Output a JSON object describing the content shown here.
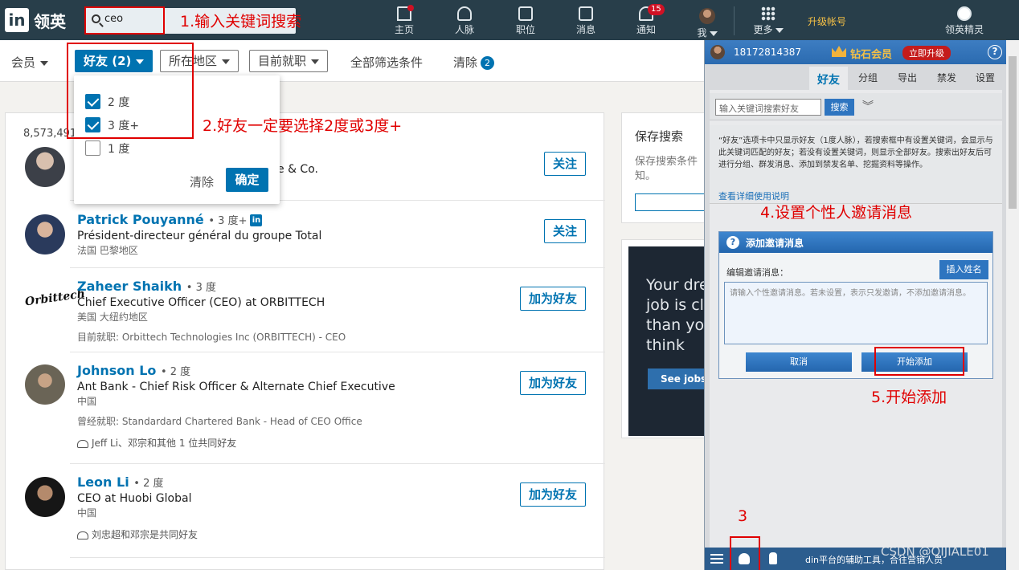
{
  "topnav": {
    "logo_in": "in",
    "logo_text": "领英",
    "search_value": "ceo",
    "items": [
      {
        "label": "主页",
        "icon": "home-icon"
      },
      {
        "label": "人脉",
        "icon": "network-icon"
      },
      {
        "label": "职位",
        "icon": "jobs-icon"
      },
      {
        "label": "消息",
        "icon": "messages-icon"
      },
      {
        "label": "通知",
        "icon": "bell-icon",
        "badge": "15"
      },
      {
        "label": "我",
        "icon": "avatar"
      },
      {
        "label": "更多",
        "icon": "grid-icon"
      }
    ],
    "upgrade": "升级帐号",
    "sales_label": "领英精灵"
  },
  "annotations": {
    "step1": "1.输入关键词搜索",
    "step2": "2.好友一定要选择2度或3度+",
    "step3": "3",
    "step4": "4.设置个性人邀请消息",
    "step5": "5.开始添加"
  },
  "filters": {
    "members": "会员",
    "friends": "好友 (2)",
    "region": "所在地区",
    "current_company": "目前就职",
    "all_filters": "全部筛选条件",
    "clear": "清除",
    "clear_count": "2"
  },
  "dropdown": {
    "options": [
      {
        "label": "2 度",
        "checked": true
      },
      {
        "label": "3 度+",
        "checked": true
      },
      {
        "label": "1 度",
        "checked": false
      }
    ],
    "clear": "清除",
    "ok": "确定"
  },
  "results": {
    "count": "8,573,491",
    "first_partial": "e & Co.",
    "first_action": "关注",
    "items": [
      {
        "name": "Patrick Pouyanné",
        "degree": "• 3 度+",
        "title": "Président-directeur général du groupe Total",
        "location": "法国 巴黎地区",
        "action": "关注"
      },
      {
        "name": "Zaheer Shaikh",
        "degree": "• 3 度",
        "title": "Chief Executive Officer (CEO) at ORBITTECH",
        "location": "美国 大纽约地区",
        "current": "目前就职: Orbittech Technologies Inc (ORBITTECH) - CEO",
        "action": "加为好友",
        "logo_text": "Orbittech"
      },
      {
        "name": "Johnson Lo",
        "degree": "• 2 度",
        "title": "Ant Bank - Chief Risk Officer & Alternate Chief Executive",
        "location": "中国",
        "current": "曾经就职: Standardard Chartered Bank - Head of CEO Office",
        "mutual": "Jeff Li、邓宗和其他 1 位共同好友",
        "action": "加为好友"
      },
      {
        "name": "Leon Li",
        "degree": "• 2 度",
        "title": "CEO at Huobi Global",
        "location": "中国",
        "mutual": "刘忠超和邓宗是共同好友",
        "action": "加为好友"
      }
    ]
  },
  "save_search": {
    "title": "保存搜索",
    "desc": "保存搜索条件\n知。"
  },
  "ad": {
    "text": "Your dre\njob is cl\nthan yo\nthink",
    "button": "See jobs"
  },
  "panel": {
    "phone": "18172814387",
    "tier": "钻石会员",
    "upgrade": "立即升级",
    "help": "?",
    "tabs": [
      "好友",
      "分组",
      "导出",
      "禁发",
      "设置"
    ],
    "search_placeholder": "输入关键词搜索好友",
    "search_button": "搜索",
    "info": "“好友”选项卡中只显示好友（1度人脉），若搜索框中有设置关键词，会显示与此关键词匹配的好友；若没有设置关键词，则显示全部好友。搜索出好友后可进行分组、群发消息、添加到禁发名单、挖掘资料等操作。",
    "info_link": "查看详细使用说明",
    "bottom_text": "din平台的辅助工具，合往营销人员"
  },
  "dialog": {
    "title": "添加邀请消息",
    "label": "编辑邀请消息：",
    "insert": "插入姓名",
    "placeholder": "请输入个性邀请消息。若未设置，表示只发邀请，不添加邀请消息。",
    "cancel": "取消",
    "start": "开始添加"
  },
  "watermark": "CSDN @QIJIALE01",
  "colors": {
    "nav_bg": "#283e4a",
    "brand_blue": "#0073b1",
    "annotation_red": "#e00000",
    "panel_blue": "#2c5d8e"
  }
}
